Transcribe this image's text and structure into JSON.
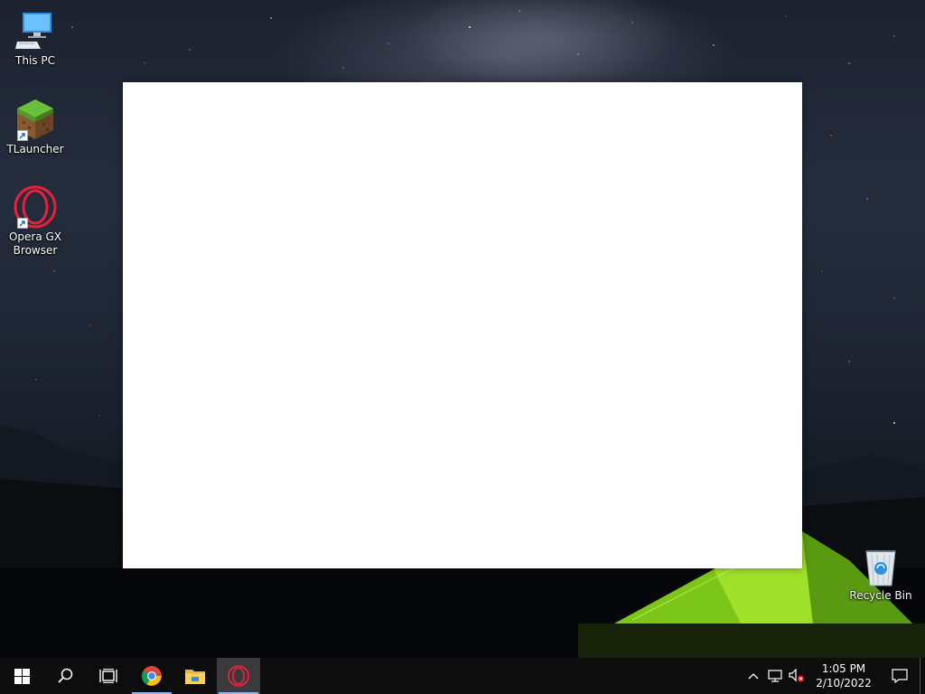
{
  "desktop": {
    "icons": [
      {
        "label": "This PC",
        "icon": "computer-icon"
      },
      {
        "label": "TLauncher",
        "icon": "minecraft-grass-block-icon"
      },
      {
        "label": "Opera GX Browser",
        "icon": "opera-gx-icon"
      },
      {
        "label": "Recycle Bin",
        "icon": "recycle-bin-icon"
      }
    ]
  },
  "window": {
    "content": ""
  },
  "taskbar": {
    "start": {
      "icon": "windows-logo-icon"
    },
    "search": {
      "icon": "search-icon"
    },
    "task_view": {
      "icon": "task-view-icon"
    },
    "apps": [
      {
        "name": "Google Chrome",
        "icon": "chrome-icon",
        "state": "running"
      },
      {
        "name": "File Explorer",
        "icon": "folder-icon",
        "state": "pinned"
      },
      {
        "name": "Opera GX",
        "icon": "opera-gx-icon",
        "state": "active"
      }
    ],
    "tray": {
      "icons": [
        "chevron-up-icon",
        "network-icon",
        "volume-muted-icon"
      ],
      "time": "1:05 PM",
      "date": "2/10/2022",
      "notification_icon": "action-center-icon"
    }
  },
  "colors": {
    "taskbar_bg": "#0d0d0e",
    "active_underline": "#8fb8e8",
    "opera_red": "#e8213b",
    "tent_green": "#8bd11e"
  }
}
